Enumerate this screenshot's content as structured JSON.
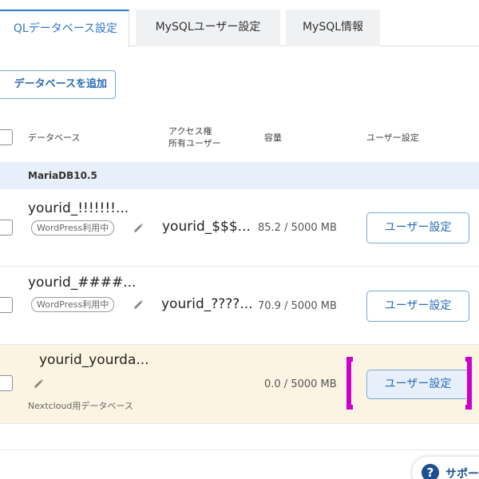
{
  "tabs": [
    {
      "label": "QLデータベース設定"
    },
    {
      "label": "MySQLユーザー設定"
    },
    {
      "label": "MySQL情報"
    }
  ],
  "add_db_label": "データベースを追加",
  "table_header": {
    "database": "データベース",
    "access_line1": "アクセス権",
    "access_line2": "所有ユーザー",
    "capacity": "容量",
    "user_settings": "ユーザー設定"
  },
  "group_label": "MariaDB10.5",
  "rows": [
    {
      "name": "yourid_!!!!!!!...",
      "badge": "WordPress利用中",
      "user": "yourid_$$$...",
      "capacity": "85.2 / 5000 MB",
      "button": "ユーザー設定"
    },
    {
      "name": "yourid_####...",
      "badge": "WordPress利用中",
      "user": "yourid_????...",
      "capacity": "70.9 / 5000 MB",
      "button": "ユーザー設定"
    },
    {
      "name": "yourid_yourda...",
      "description": "Nextcloud用データベース",
      "capacity": "0.0 / 5000 MB",
      "button": "ユーザー設定"
    }
  ],
  "support": {
    "icon": "question-mark-icon",
    "icon_glyph": "?",
    "label": "サポー"
  },
  "colors": {
    "accent": "#2f79c9",
    "highlight_row": "#fbf4e2",
    "group_row": "#e7effa",
    "annotation": "#cc00cc"
  }
}
